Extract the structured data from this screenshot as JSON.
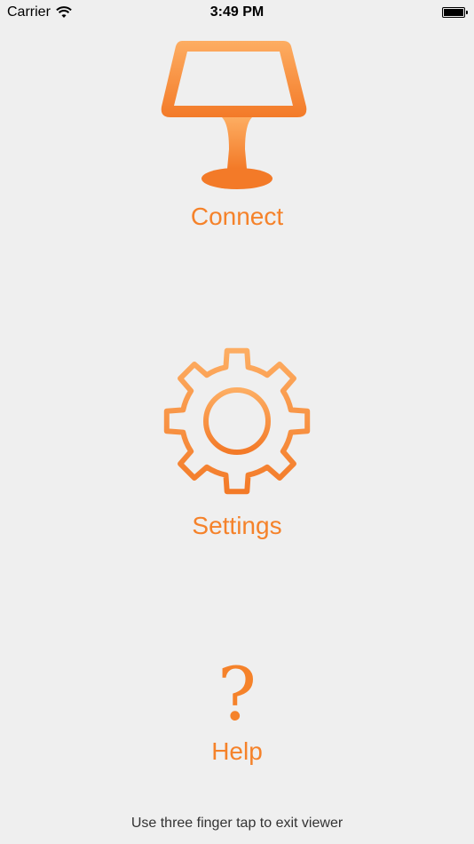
{
  "status_bar": {
    "carrier": "Carrier",
    "time": "3:49 PM",
    "wifi_icon": "wifi-icon",
    "battery_icon": "battery-icon"
  },
  "menu": {
    "connect": {
      "label": "Connect",
      "icon": "lamp-icon"
    },
    "settings": {
      "label": "Settings",
      "icon": "gear-icon"
    },
    "help": {
      "label": "Help",
      "icon": "question-mark-icon",
      "glyph": "?"
    }
  },
  "footer": {
    "hint": "Use three finger tap to exit viewer"
  },
  "colors": {
    "accent_light": "#fdad62",
    "accent_dark": "#f37a28",
    "background": "#efefef"
  }
}
